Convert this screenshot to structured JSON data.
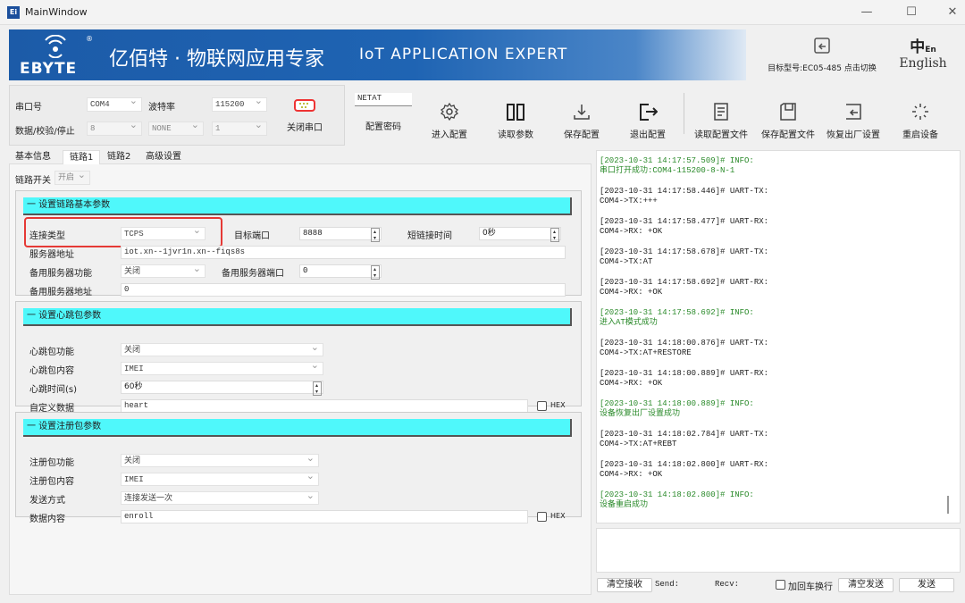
{
  "window": {
    "title": "MainWindow",
    "app_icon": "Ei",
    "minimize": "—",
    "maximize": "☐",
    "close": "✕"
  },
  "banner": {
    "logo": "EBYTE",
    "registered": "®",
    "slogan_cn": "亿佰特 · 物联网应用专家",
    "slogan_en": "IoT APPLICATION EXPERT",
    "colors": {
      "brand": "#1c5ba8"
    }
  },
  "target": {
    "label": "目标型号:EC05-485 点击切换"
  },
  "language": {
    "label": "English"
  },
  "serial": {
    "port_label": "串口号",
    "port_value": "COM4",
    "baud_label": "波特率",
    "baud_value": "115200",
    "dps_label": "数据/校验/停止",
    "data_bits": "8",
    "parity": "NONE",
    "stop_bits": "1",
    "close_label": "关闭串口"
  },
  "password": {
    "value": "NETAT",
    "label": "配置密码"
  },
  "toolbar": [
    {
      "label": "进入配置",
      "icon": "gear-icon"
    },
    {
      "label": "读取参数",
      "icon": "book-icon"
    },
    {
      "label": "保存配置",
      "icon": "download-icon"
    },
    {
      "label": "退出配置",
      "icon": "exit-icon"
    },
    {
      "label": "读取配置文件",
      "icon": "file-read-icon"
    },
    {
      "label": "保存配置文件",
      "icon": "save-file-icon"
    },
    {
      "label": "恢复出厂设置",
      "icon": "restore-icon"
    },
    {
      "label": "重启设备",
      "icon": "restart-icon"
    }
  ],
  "tabs": [
    "基本信息",
    "链路1",
    "链路2",
    "高级设置"
  ],
  "active_tab": "链路1",
  "link_switch": {
    "label": "链路开关",
    "value": "开启"
  },
  "sections": [
    {
      "title": "一 设置链路基本参数",
      "rows": [
        [
          {
            "label": "连接类型",
            "type": "select",
            "value": "TCPS",
            "highlight": true
          },
          {
            "label": "目标端口",
            "type": "spin",
            "value": "8888"
          },
          {
            "label": "短链接时间",
            "type": "spin",
            "value": "0秒"
          }
        ],
        [
          {
            "label": "服务器地址",
            "type": "input",
            "value": "iot.xn--1jvr1n.xn--fiqs8s"
          }
        ],
        [
          {
            "label": "备用服务器功能",
            "type": "select",
            "value": "关闭"
          },
          {
            "label": "备用服务器端口",
            "type": "spin",
            "value": "0"
          }
        ],
        [
          {
            "label": "备用服务器地址",
            "type": "input",
            "value": "0"
          }
        ]
      ]
    },
    {
      "title": "一 设置心跳包参数",
      "rows": [
        [
          {
            "label": "心跳包功能",
            "type": "select",
            "value": "关闭"
          }
        ],
        [
          {
            "label": "心跳包内容",
            "type": "select",
            "value": "IMEI"
          }
        ],
        [
          {
            "label": "心跳时间(s)",
            "type": "spin",
            "value": "60秒"
          }
        ],
        [
          {
            "label": "自定义数据",
            "type": "input",
            "value": "heart",
            "hex": "HEX"
          }
        ]
      ]
    },
    {
      "title": "一 设置注册包参数",
      "rows": [
        [
          {
            "label": "注册包功能",
            "type": "select",
            "value": "关闭"
          }
        ],
        [
          {
            "label": "注册包内容",
            "type": "select",
            "value": "IMEI"
          }
        ],
        [
          {
            "label": "发送方式",
            "type": "select",
            "value": "连接发送一次"
          }
        ],
        [
          {
            "label": "数据内容",
            "type": "input",
            "value": "enroll",
            "hex": "HEX"
          }
        ]
      ]
    }
  ],
  "log": [
    {
      "kind": "info",
      "head": "[2023-10-31 14:17:57.509]# INFO:",
      "body": "串口打开成功:COM4-115200-8-N-1"
    },
    {
      "kind": "tx",
      "head": "[2023-10-31 14:17:58.446]# UART-TX:",
      "body": "COM4->TX:+++"
    },
    {
      "kind": "rx",
      "head": "[2023-10-31 14:17:58.477]# UART-RX:",
      "body": "COM4->RX: +OK"
    },
    {
      "kind": "tx",
      "head": "[2023-10-31 14:17:58.678]# UART-TX:",
      "body": "COM4->TX:AT"
    },
    {
      "kind": "rx",
      "head": "[2023-10-31 14:17:58.692]# UART-RX:",
      "body": "COM4->RX: +OK"
    },
    {
      "kind": "info",
      "head": "[2023-10-31 14:17:58.692]# INFO:",
      "body": "进入AT模式成功"
    },
    {
      "kind": "tx",
      "head": "[2023-10-31 14:18:00.876]# UART-TX:",
      "body": "COM4->TX:AT+RESTORE"
    },
    {
      "kind": "rx",
      "head": "[2023-10-31 14:18:00.889]# UART-RX:",
      "body": "COM4->RX: +OK"
    },
    {
      "kind": "info",
      "head": "[2023-10-31 14:18:00.889]# INFO:",
      "body": "设备恢复出厂设置成功"
    },
    {
      "kind": "tx",
      "head": "[2023-10-31 14:18:02.784]# UART-TX:",
      "body": "COM4->TX:AT+REBT"
    },
    {
      "kind": "rx",
      "head": "[2023-10-31 14:18:02.800]# UART-RX:",
      "body": "COM4->RX: +OK"
    },
    {
      "kind": "info",
      "head": "[2023-10-31 14:18:02.800]# INFO:",
      "body": "设备重启成功"
    }
  ],
  "bottom": {
    "clear_recv": "清空接收",
    "send_label": "Send:",
    "recv_label": "Recv:",
    "crlf_label": "加回车换行",
    "clear_send": "清空发送",
    "send_button": "发送"
  }
}
